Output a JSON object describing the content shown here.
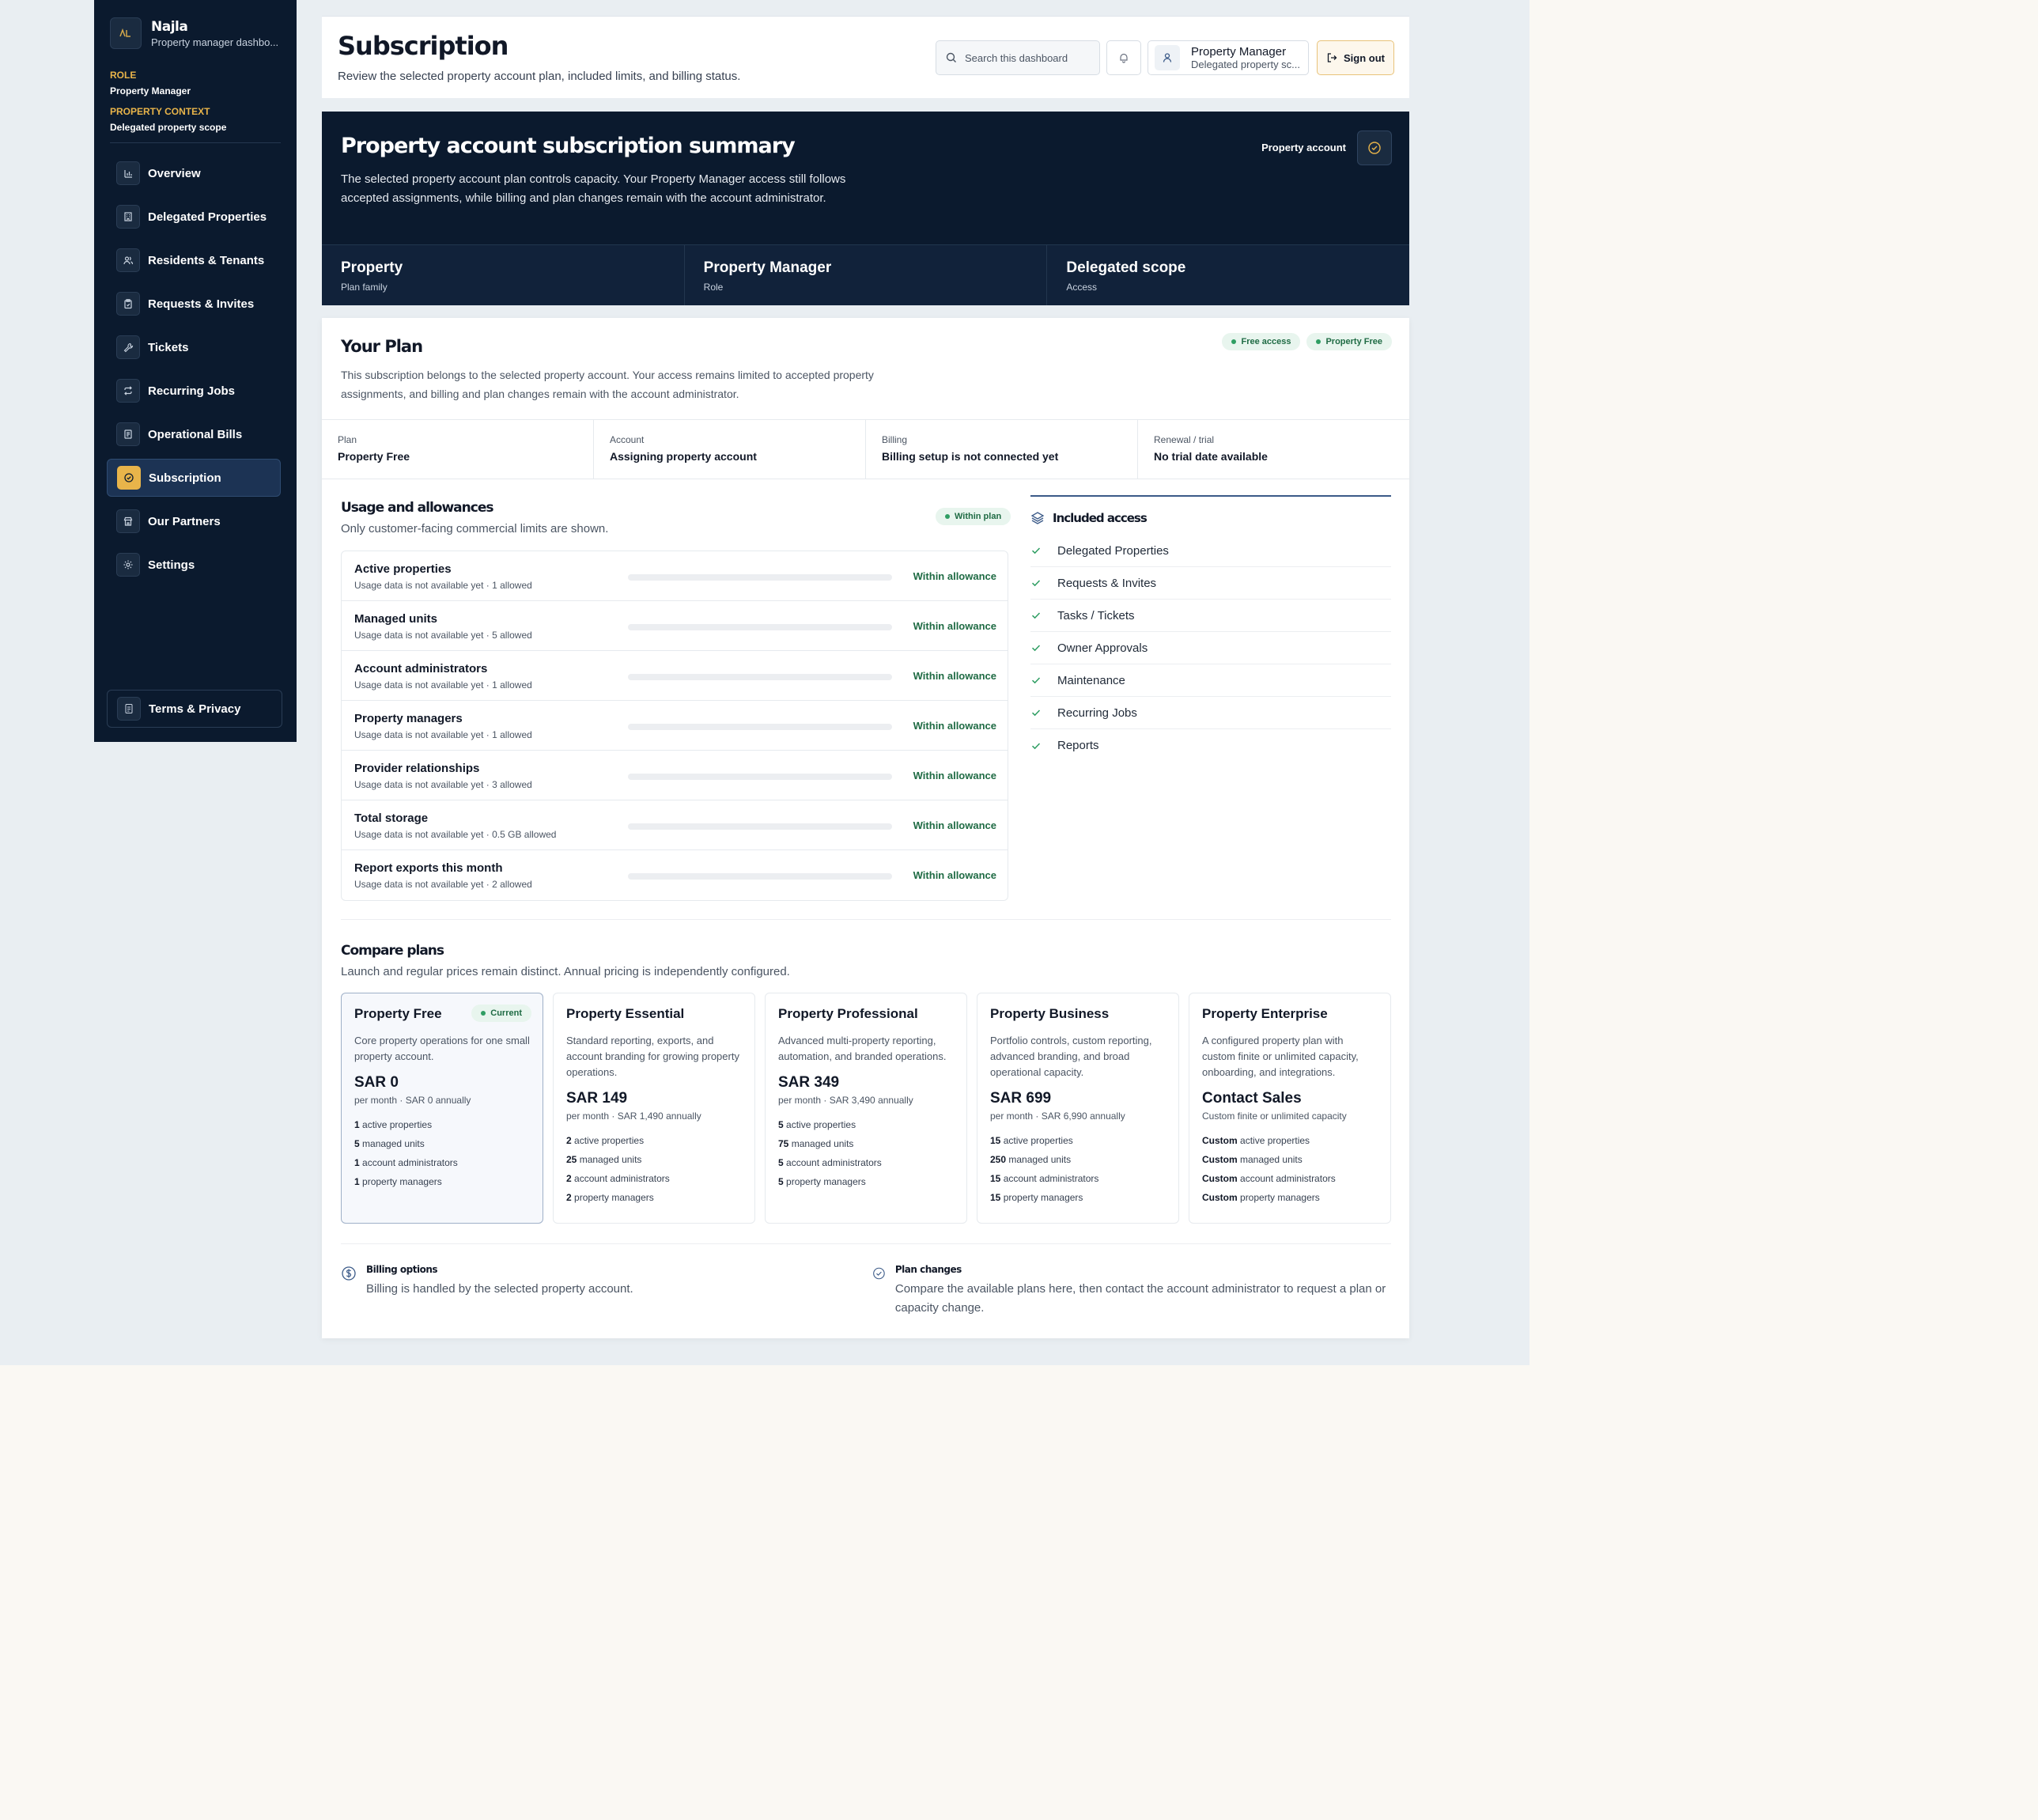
{
  "brand": {
    "name": "Najla",
    "subtitle": "Property manager dashbo...",
    "logo": "najla-logo"
  },
  "context": {
    "role_label": "ROLE",
    "role_value": "Property Manager",
    "property_label": "PROPERTY CONTEXT",
    "property_value": "Delegated property scope"
  },
  "nav": {
    "items": [
      {
        "label": "Overview",
        "icon": "chart-icon"
      },
      {
        "label": "Delegated Properties",
        "icon": "building-icon"
      },
      {
        "label": "Residents & Tenants",
        "icon": "users-icon"
      },
      {
        "label": "Requests & Invites",
        "icon": "clipboard-icon"
      },
      {
        "label": "Tickets",
        "icon": "wrench-icon"
      },
      {
        "label": "Recurring Jobs",
        "icon": "repeat-icon"
      },
      {
        "label": "Operational Bills",
        "icon": "receipt-icon"
      },
      {
        "label": "Subscription",
        "icon": "check-circle-icon",
        "active": true
      },
      {
        "label": "Our Partners",
        "icon": "store-icon"
      },
      {
        "label": "Settings",
        "icon": "gear-icon"
      }
    ],
    "terms": "Terms & Privacy"
  },
  "header": {
    "title": "Subscription",
    "subtitle": "Review the selected property account plan, included limits, and billing status.",
    "search_placeholder": "Search this dashboard",
    "user_name": "Property Manager",
    "user_sub": "Delegated property sc...",
    "sign_out": "Sign out"
  },
  "summary": {
    "title": "Property account subscription summary",
    "description": "The selected property account plan controls capacity. Your Property Manager access still follows accepted assignments, while billing and plan changes remain with the account administrator.",
    "account_label": "Property account",
    "cells": [
      {
        "value": "Property",
        "label": "Plan family"
      },
      {
        "value": "Property Manager",
        "label": "Role"
      },
      {
        "value": "Delegated scope",
        "label": "Access"
      }
    ]
  },
  "plan": {
    "title": "Your Plan",
    "description": "This subscription belongs to the selected property account. Your access remains limited to accepted property assignments, and billing and plan changes remain with the account administrator.",
    "badges": [
      "Free access",
      "Property Free"
    ],
    "facts": [
      {
        "label": "Plan",
        "value": "Property Free"
      },
      {
        "label": "Account",
        "value": "Assigning property account"
      },
      {
        "label": "Billing",
        "value": "Billing setup is not connected yet"
      },
      {
        "label": "Renewal / trial",
        "value": "No trial date available"
      }
    ]
  },
  "usage": {
    "title": "Usage and allowances",
    "subtitle": "Only customer-facing commercial limits are shown.",
    "badge": "Within plan",
    "rows": [
      {
        "name": "Active properties",
        "detail": "Usage data is not available yet · 1 allowed",
        "status": "Within allowance",
        "usage_fraction": 0
      },
      {
        "name": "Managed units",
        "detail": "Usage data is not available yet · 5 allowed",
        "status": "Within allowance",
        "usage_fraction": 0
      },
      {
        "name": "Account administrators",
        "detail": "Usage data is not available yet · 1 allowed",
        "status": "Within allowance",
        "usage_fraction": 0
      },
      {
        "name": "Property managers",
        "detail": "Usage data is not available yet · 1 allowed",
        "status": "Within allowance",
        "usage_fraction": 0
      },
      {
        "name": "Provider relationships",
        "detail": "Usage data is not available yet · 3 allowed",
        "status": "Within allowance",
        "usage_fraction": 0
      },
      {
        "name": "Total storage",
        "detail": "Usage data is not available yet · 0.5 GB allowed",
        "status": "Within allowance",
        "usage_fraction": 0
      },
      {
        "name": "Report exports this month",
        "detail": "Usage data is not available yet · 2 allowed",
        "status": "Within allowance",
        "usage_fraction": 0
      }
    ]
  },
  "included": {
    "title": "Included access",
    "items": [
      "Delegated Properties",
      "Requests & Invites",
      "Tasks / Tickets",
      "Owner Approvals",
      "Maintenance",
      "Recurring Jobs",
      "Reports"
    ]
  },
  "compare": {
    "title": "Compare plans",
    "subtitle": "Launch and regular prices remain distinct. Annual pricing is independently configured.",
    "current_label": "Current",
    "plans": [
      {
        "name": "Property Free",
        "current": true,
        "description": "Core property operations for one small property account.",
        "price": "SAR 0",
        "period": "per month · SAR 0 annually",
        "limits": [
          {
            "qty": "1",
            "text": "active properties"
          },
          {
            "qty": "5",
            "text": "managed units"
          },
          {
            "qty": "1",
            "text": "account administrators"
          },
          {
            "qty": "1",
            "text": "property managers"
          }
        ]
      },
      {
        "name": "Property Essential",
        "description": "Standard reporting, exports, and account branding for growing property operations.",
        "price": "SAR 149",
        "period": "per month · SAR 1,490 annually",
        "limits": [
          {
            "qty": "2",
            "text": "active properties"
          },
          {
            "qty": "25",
            "text": "managed units"
          },
          {
            "qty": "2",
            "text": "account administrators"
          },
          {
            "qty": "2",
            "text": "property managers"
          }
        ]
      },
      {
        "name": "Property Professional",
        "description": "Advanced multi-property reporting, automation, and branded operations.",
        "price": "SAR 349",
        "period": "per month · SAR 3,490 annually",
        "limits": [
          {
            "qty": "5",
            "text": "active properties"
          },
          {
            "qty": "75",
            "text": "managed units"
          },
          {
            "qty": "5",
            "text": "account administrators"
          },
          {
            "qty": "5",
            "text": "property managers"
          }
        ]
      },
      {
        "name": "Property Business",
        "description": "Portfolio controls, custom reporting, advanced branding, and broad operational capacity.",
        "price": "SAR 699",
        "period": "per month · SAR 6,990 annually",
        "limits": [
          {
            "qty": "15",
            "text": "active properties"
          },
          {
            "qty": "250",
            "text": "managed units"
          },
          {
            "qty": "15",
            "text": "account administrators"
          },
          {
            "qty": "15",
            "text": "property managers"
          }
        ]
      },
      {
        "name": "Property Enterprise",
        "description": "A configured property plan with custom finite or unlimited capacity, onboarding, and integrations.",
        "price": "Contact Sales",
        "period": "Custom finite or unlimited capacity",
        "limits": [
          {
            "qty": "Custom",
            "text": "active properties"
          },
          {
            "qty": "Custom",
            "text": "managed units"
          },
          {
            "qty": "Custom",
            "text": "account administrators"
          },
          {
            "qty": "Custom",
            "text": "property managers"
          }
        ]
      }
    ]
  },
  "footer": {
    "billing_title": "Billing options",
    "billing_text": "Billing is handled by the selected property account.",
    "changes_title": "Plan changes",
    "changes_text": "Compare the available plans here, then contact the account administrator to request a plan or capacity change."
  },
  "colors": {
    "navy": "#0b1a2e",
    "accent": "#e8b44a",
    "success": "#2f9e63"
  }
}
